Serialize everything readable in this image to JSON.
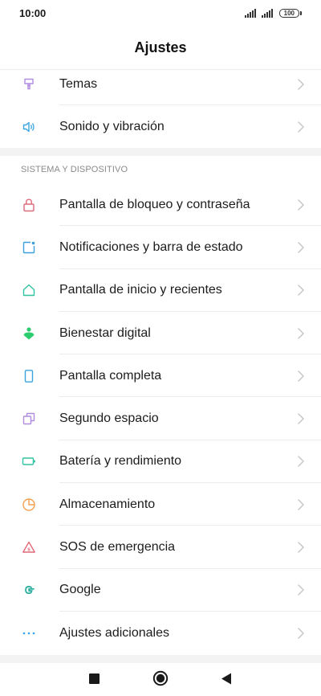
{
  "status_bar": {
    "time": "10:00",
    "battery": "100"
  },
  "header": {
    "title": "Ajustes"
  },
  "group_top": [
    {
      "label": "Temas",
      "icon": "brush-icon",
      "color": "#b08be0"
    },
    {
      "label": "Sonido y vibración",
      "icon": "speaker-icon",
      "color": "#3aa4e0"
    }
  ],
  "section": {
    "title": "SISTEMA Y DISPOSITIVO"
  },
  "group_system": [
    {
      "label": "Pantalla de bloqueo y contraseña",
      "icon": "lock-icon",
      "color": "#e06a7a"
    },
    {
      "label": "Notificaciones y barra de estado",
      "icon": "notification-icon",
      "color": "#3a9fe0"
    },
    {
      "label": "Pantalla de inicio y recientes",
      "icon": "home-icon",
      "color": "#2fc4a0"
    },
    {
      "label": "Bienestar digital",
      "icon": "wellbeing-icon",
      "color": "#2ecc71"
    },
    {
      "label": "Pantalla completa",
      "icon": "phone-icon",
      "color": "#3aa4e0"
    },
    {
      "label": "Segundo espacio",
      "icon": "second-space-icon",
      "color": "#b08be0"
    },
    {
      "label": "Batería y rendimiento",
      "icon": "battery-icon",
      "color": "#2fc4a0"
    },
    {
      "label": "Almacenamiento",
      "icon": "storage-pie-icon",
      "color": "#f0a050"
    },
    {
      "label": "SOS de emergencia",
      "icon": "sos-icon",
      "color": "#e06a7a"
    },
    {
      "label": "Google",
      "icon": "google-icon",
      "color": "#2fb0a0"
    },
    {
      "label": "Ajustes adicionales",
      "icon": "more-dots-icon",
      "color": "#3aa4e0"
    }
  ],
  "colors": {
    "chevron": "#c4c4c4",
    "divider": "#ececec",
    "section_text": "#8a8a8a"
  },
  "nav": {
    "recents_icon": "square-icon",
    "home_icon": "circle-home-icon",
    "back_icon": "triangle-back-icon"
  }
}
